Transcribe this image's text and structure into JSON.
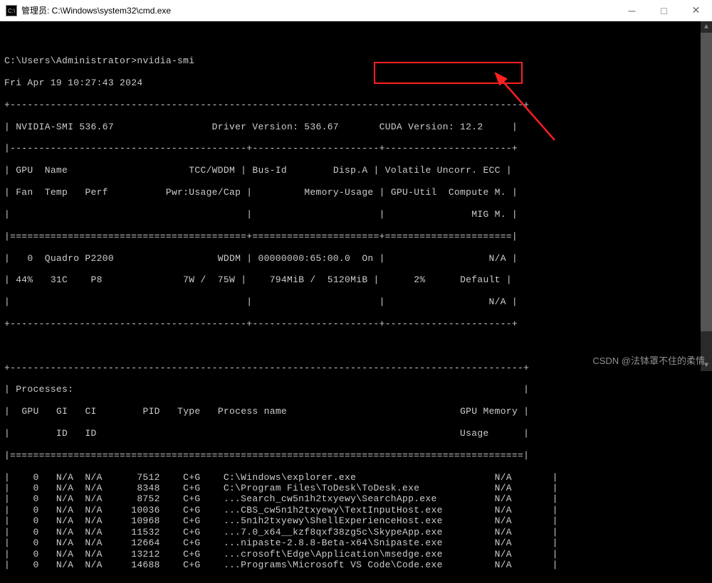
{
  "window": {
    "title": "管理员: C:\\Windows\\system32\\cmd.exe"
  },
  "prompt": "C:\\Users\\Administrator>",
  "command": "nvidia-smi",
  "timestamp": "Fri Apr 19 10:27:43 2024",
  "smi": {
    "driver_label": "NVIDIA-SMI 536.67",
    "driver_version_label": "Driver Version: 536.67",
    "cuda_version_label": "CUDA Version: 12.2",
    "headers_row1": {
      "gpu": "GPU",
      "name": "Name",
      "tcc": "TCC/WDDM",
      "busid": "Bus-Id",
      "dispa": "Disp.A",
      "volatile": "Volatile Uncorr. ECC"
    },
    "headers_row2": {
      "fan": "Fan",
      "temp": "Temp",
      "perf": "Perf",
      "pwr": "Pwr:Usage/Cap",
      "memusage": "Memory-Usage",
      "gpuutil": "GPU-Util",
      "compute": "Compute M."
    },
    "headers_row3": {
      "mig": "MIG M."
    },
    "gpu": {
      "id": "0",
      "name": "Quadro P2200",
      "mode": "WDDM",
      "busid": "00000000:65:00.0",
      "disp": "On",
      "ecc": "N/A",
      "fan": "44%",
      "temp": "31C",
      "perf": "P8",
      "pwr": "7W /  75W",
      "mem": "794MiB /  5120MiB",
      "util": "2%",
      "compute": "Default",
      "mig": "N/A"
    }
  },
  "proc_section_label": "Processes:",
  "proc_headers_row1": {
    "gpu": "GPU",
    "gi": "GI",
    "ci": "CI",
    "pid": "PID",
    "type": "Type",
    "pname": "Process name",
    "gpumem": "GPU Memory"
  },
  "proc_headers_row2": {
    "id1": "ID",
    "id2": "ID",
    "usage": "Usage"
  },
  "processes": [
    {
      "gpu": "0",
      "gi": "N/A",
      "ci": "N/A",
      "pid": "7512",
      "type": "C+G",
      "name": "C:\\Windows\\explorer.exe",
      "mem": "N/A"
    },
    {
      "gpu": "0",
      "gi": "N/A",
      "ci": "N/A",
      "pid": "8348",
      "type": "C+G",
      "name": "C:\\Program Files\\ToDesk\\ToDesk.exe",
      "mem": "N/A"
    },
    {
      "gpu": "0",
      "gi": "N/A",
      "ci": "N/A",
      "pid": "8752",
      "type": "C+G",
      "name": "...Search_cw5n1h2txyewy\\SearchApp.exe",
      "mem": "N/A"
    },
    {
      "gpu": "0",
      "gi": "N/A",
      "ci": "N/A",
      "pid": "10036",
      "type": "C+G",
      "name": "...CBS_cw5n1h2txyewy\\TextInputHost.exe",
      "mem": "N/A"
    },
    {
      "gpu": "0",
      "gi": "N/A",
      "ci": "N/A",
      "pid": "10968",
      "type": "C+G",
      "name": "...5n1h2txyewy\\ShellExperienceHost.exe",
      "mem": "N/A"
    },
    {
      "gpu": "0",
      "gi": "N/A",
      "ci": "N/A",
      "pid": "11532",
      "type": "C+G",
      "name": "...7.0_x64__kzf8qxf38zg5c\\SkypeApp.exe",
      "mem": "N/A"
    },
    {
      "gpu": "0",
      "gi": "N/A",
      "ci": "N/A",
      "pid": "12664",
      "type": "C+G",
      "name": "...nipaste-2.8.8-Beta-x64\\Snipaste.exe",
      "mem": "N/A"
    },
    {
      "gpu": "0",
      "gi": "N/A",
      "ci": "N/A",
      "pid": "13212",
      "type": "C+G",
      "name": "...crosoft\\Edge\\Application\\msedge.exe",
      "mem": "N/A"
    },
    {
      "gpu": "0",
      "gi": "N/A",
      "ci": "N/A",
      "pid": "14688",
      "type": "C+G",
      "name": "...Programs\\Microsoft VS Code\\Code.exe",
      "mem": "N/A"
    }
  ],
  "colors": {
    "highlight": "#ff2020",
    "terminal_fg": "#cccccc",
    "terminal_bg": "#000000"
  },
  "watermark": "CSDN @法钵罩不住的柔情"
}
